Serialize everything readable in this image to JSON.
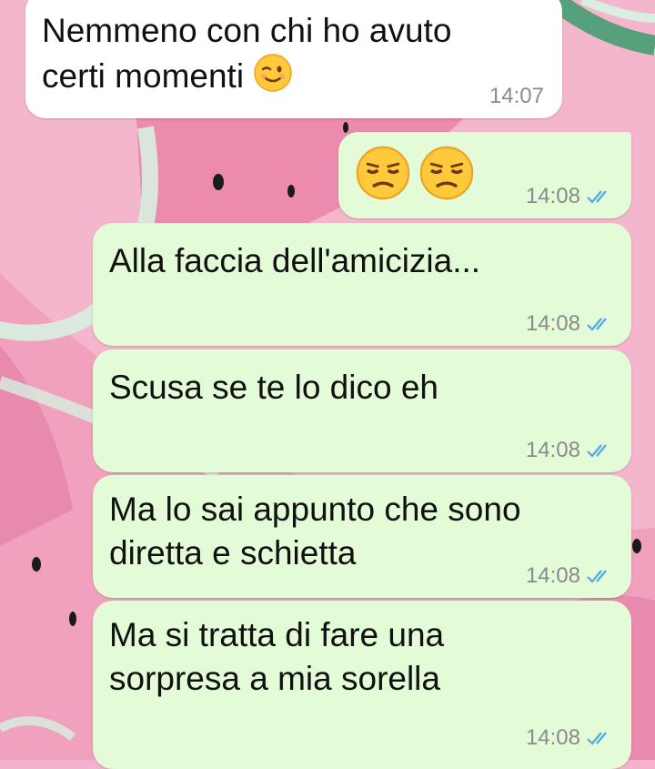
{
  "messages": [
    {
      "text": "Nemmeno con chi ho avuto\ncerti momenti",
      "emoji": "wink-emoji",
      "time": "14:07",
      "direction": "incoming"
    },
    {
      "emojis": [
        "unamused-emoji",
        "unamused-emoji"
      ],
      "time": "14:08",
      "direction": "outgoing",
      "read": true
    },
    {
      "text": "Alla faccia dell'amicizia...",
      "time": "14:08",
      "direction": "outgoing",
      "read": true
    },
    {
      "text": "Scusa se te lo dico eh",
      "time": "14:08",
      "direction": "outgoing",
      "read": true
    },
    {
      "text": "Ma lo sai appunto che sono\ndiretta e schietta",
      "time": "14:08",
      "direction": "outgoing",
      "read": true
    },
    {
      "text": "Ma si tratta di fare una\nsorpresa a mia sorella",
      "time": "14:08",
      "direction": "outgoing",
      "read": true
    }
  ],
  "colors": {
    "incoming_bubble": "#ffffff",
    "outgoing_bubble": "#e4fbd8",
    "read_ticks": "#4fa8e8",
    "wallpaper_pink": "#f3b3cc",
    "watermelon_rind": "#cfe9d8"
  }
}
